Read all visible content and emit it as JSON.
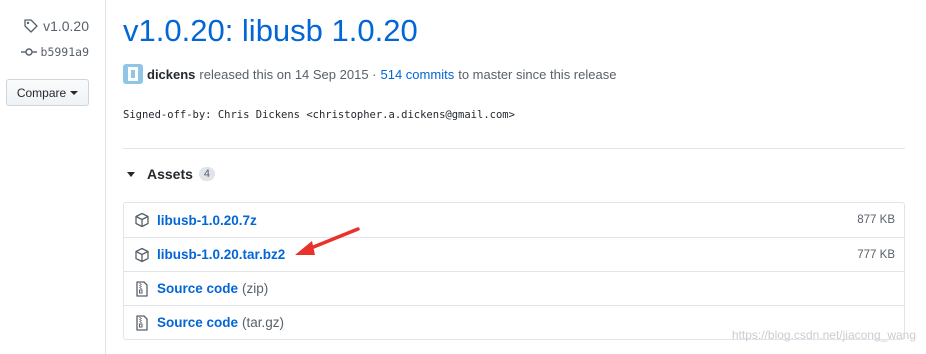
{
  "sidebar": {
    "tag_name": "v1.0.20",
    "commit_sha": "b5991a9",
    "compare_label": "Compare"
  },
  "release": {
    "title": "v1.0.20: libusb 1.0.20",
    "author": "dickens",
    "released_text": "released this on 14 Sep 2015 ·",
    "commits_link": "514 commits",
    "since_text": "to master since this release",
    "signed_off": "Signed-off-by: Chris Dickens <christopher.a.dickens@gmail.com>"
  },
  "assets": {
    "heading": "Assets",
    "count": "4",
    "files": [
      {
        "name": "libusb-1.0.20.7z",
        "size": "877 KB"
      },
      {
        "name": "libusb-1.0.20.tar.bz2",
        "size": "777 KB"
      }
    ],
    "sources": [
      {
        "label": "Source code",
        "format": "(zip)"
      },
      {
        "label": "Source code",
        "format": "(tar.gz)"
      }
    ]
  },
  "annotation": {
    "arrow_color": "#e8322b"
  },
  "watermark": "https://blog.csdn.net/jiacong_wang",
  "colors": {
    "link": "#0366d6",
    "muted": "#586069",
    "border": "#e1e4e8"
  },
  "icons": [
    "tag-icon",
    "git-commit-icon",
    "package-icon",
    "file-zip-icon",
    "triangle-down-icon",
    "arrow-annotation"
  ]
}
